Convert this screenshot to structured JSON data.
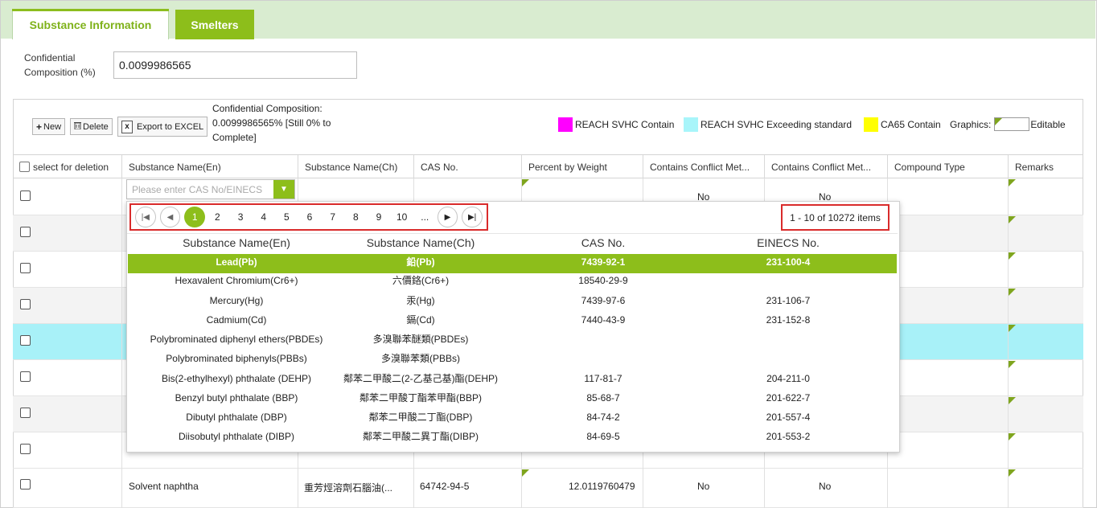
{
  "tabs": {
    "active": "Substance Information",
    "inactive": "Smelters"
  },
  "confidential": {
    "label": "Confidential Composition (%)",
    "value": "0.0099986565"
  },
  "toolbar": {
    "new": "New",
    "delete": "Delete",
    "export": "Export to EXCEL",
    "summary_title": "Confidential Composition:",
    "summary_value": "0.0099986565% [Still 0% to Complete]"
  },
  "legend": {
    "reach_svhc_contain": "REACH SVHC Contain",
    "reach_svhc_exceeding": "REACH SVHC Exceeding standard",
    "ca65_contain": "CA65 Contain",
    "graphics": "Graphics:",
    "editable": "Editable",
    "colors": {
      "magenta": "#ff00ff",
      "cyan": "#a8f5fa",
      "yellow": "#ffff00"
    }
  },
  "table": {
    "headers": [
      "select for deletion",
      "Substance Name(En)",
      "Substance Name(Ch)",
      "CAS No.",
      "Percent by Weight",
      "Contains Conflict Met...",
      "Contains Conflict Met...",
      "Compound Type",
      "Remarks"
    ],
    "row1": {
      "conflict1": "No",
      "conflict2": "No"
    },
    "last_row": {
      "name_en": "Solvent naphtha",
      "name_ch": "重芳烴溶劑石腦油(...",
      "cas": "64742-94-5",
      "percent": "12.0119760479",
      "conflict1": "No",
      "conflict2": "No"
    }
  },
  "combo": {
    "placeholder": "Please enter CAS No/EINECS"
  },
  "popup": {
    "pages": [
      "1",
      "2",
      "3",
      "4",
      "5",
      "6",
      "7",
      "8",
      "9",
      "10",
      "..."
    ],
    "info": "1 - 10 of 10272 items",
    "headers": [
      "Substance Name(En)",
      "Substance Name(Ch)",
      "CAS No.",
      "EINECS No."
    ],
    "rows": [
      [
        "Lead(Pb)",
        "鉛(Pb)",
        "7439-92-1",
        "231-100-4"
      ],
      [
        "Hexavalent Chromium(Cr6+)",
        "六價鉻(Cr6+)",
        "18540-29-9",
        ""
      ],
      [
        "Mercury(Hg)",
        "汞(Hg)",
        "7439-97-6",
        "231-106-7"
      ],
      [
        "Cadmium(Cd)",
        "鎘(Cd)",
        "7440-43-9",
        "231-152-8"
      ],
      [
        "Polybrominated diphenyl ethers(PBDEs)",
        "多溴聯苯醚類(PBDEs)",
        "",
        ""
      ],
      [
        "Polybrominated biphenyls(PBBs)",
        "多溴聯苯類(PBBs)",
        "",
        ""
      ],
      [
        "Bis(2-ethylhexyl) phthalate (DEHP)",
        "鄰苯二甲酸二(2-乙基己基)酯(DEHP)",
        "117-81-7",
        "204-211-0"
      ],
      [
        "Benzyl butyl phthalate (BBP)",
        "鄰苯二甲酸丁酯苯甲酯(BBP)",
        "85-68-7",
        "201-622-7"
      ],
      [
        "Dibutyl phthalate (DBP)",
        "鄰苯二甲酸二丁酯(DBP)",
        "84-74-2",
        "201-557-4"
      ],
      [
        "Diisobutyl phthalate (DIBP)",
        "鄰苯二甲酸二異丁酯(DIBP)",
        "84-69-5",
        "201-553-2"
      ]
    ]
  }
}
